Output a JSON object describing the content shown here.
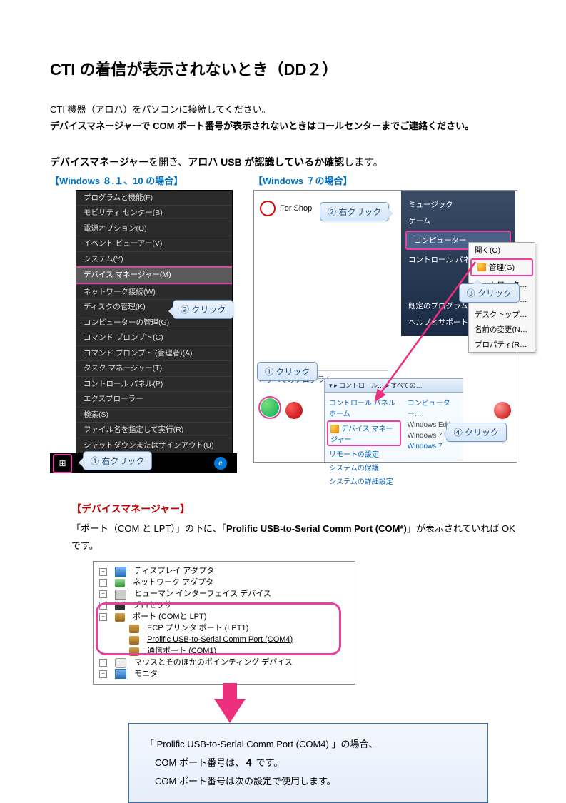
{
  "title": "CTI の着信が表示されないとき（DD２）",
  "intro1": "CTI 機器（アロハ）をパソコンに接続してください。",
  "intro2": "デバイスマネージャーで COM ポート番号が表示されないときはコールセンターまでご連絡ください。",
  "subhead_pre": "デバイスマネージャー",
  "subhead_mid": "を開き、",
  "subhead_bold2": "アロハ USB が認識しているか確認",
  "subhead_post": "します。",
  "cap81": "【Windows ８.１、10 の場合】",
  "cap7": "【Windows ７の場合】",
  "menu": {
    "items": [
      "プログラムと機能(F)",
      "モビリティ センター(B)",
      "電源オプション(O)",
      "イベント ビューアー(V)",
      "システム(Y)",
      "デバイス マネージャー(M)",
      "ネットワーク接続(W)",
      "ディスクの管理(K)",
      "コンピューターの管理(G)",
      "コマンド プロンプト(C)",
      "コマンド プロンプト (管理者)(A)",
      "タスク マネージャー(T)",
      "コントロール パネル(P)",
      "エクスプローラー",
      "検索(S)",
      "ファイル名を指定して実行(R)",
      "シャットダウンまたはサインアウト(U)"
    ],
    "highlight_index": 5
  },
  "callouts": {
    "l_start": "① 右クリック",
    "l_click": "② クリック",
    "r_rc": "② 右クリック",
    "r_click3": "③ クリック",
    "r_click1": "① クリック",
    "r_click4": "④ クリック"
  },
  "w7": {
    "app": "For Shop",
    "start_items_top": [
      "ミュージック",
      "ゲーム"
    ],
    "start_computer": "コンピューター",
    "start_items_mid": [
      "コントロール パネル",
      "既定のプログラム",
      "ヘルプとサポート"
    ],
    "ctx": {
      "open": "開く(O)",
      "manage": "管理(G)",
      "netdrive": "ネットワーク…",
      "netplace": "ネットワーク…",
      "desktop": "デスクトップ…",
      "rename": "名前の変更(N…",
      "prop": "プロパティ(R…"
    },
    "all_programs": "▸   すべてのプログラム",
    "cp_bar": "▾   ▸ コントロール… ▸ すべての…",
    "cp_left_home": "コントロール パネル ホーム",
    "cp_left_devmgr": "デバイス マネージャー",
    "cp_left_remote": "リモートの設定",
    "cp_left_protect": "システムの保護",
    "cp_left_adv": "システムの詳細設定",
    "cp_right": [
      "コンピューター…",
      "Windows Edit…",
      "Windows 7",
      "Windows 7"
    ]
  },
  "dm": {
    "header": "【デバイスマネージャー】",
    "note_pre": "「ポート（COM と LPT）」の下に、「",
    "note_bold": "Prolific USB-to-Serial Comm Port (COM*)",
    "note_post": "」が表示されていれば OK です。",
    "rows": {
      "disp": "ディスプレイ アダプタ",
      "net": "ネットワーク アダプタ",
      "hid": "ヒューマン インターフェイス デバイス",
      "cpu": "プロセッサ",
      "ports": "ポート (COMと LPT)",
      "ecp": "ECP プリンタ ポート (LPT1)",
      "prolific": "Prolific USB-to-Serial Comm Port (COM4)",
      "com1": "通信ポート (COM1)",
      "mouse": "マウスとそのほかのポインティング デバイス",
      "mon": "モニタ"
    }
  },
  "note": {
    "l1_pre": "「 Prolific USB-to-Serial Comm Port (COM4) 」の場合、",
    "l2_pre": "COM ポート番号は、",
    "l2_num": "４",
    "l2_post": " です。",
    "l3": "COM ポート番号は次の設定で使用します。"
  }
}
